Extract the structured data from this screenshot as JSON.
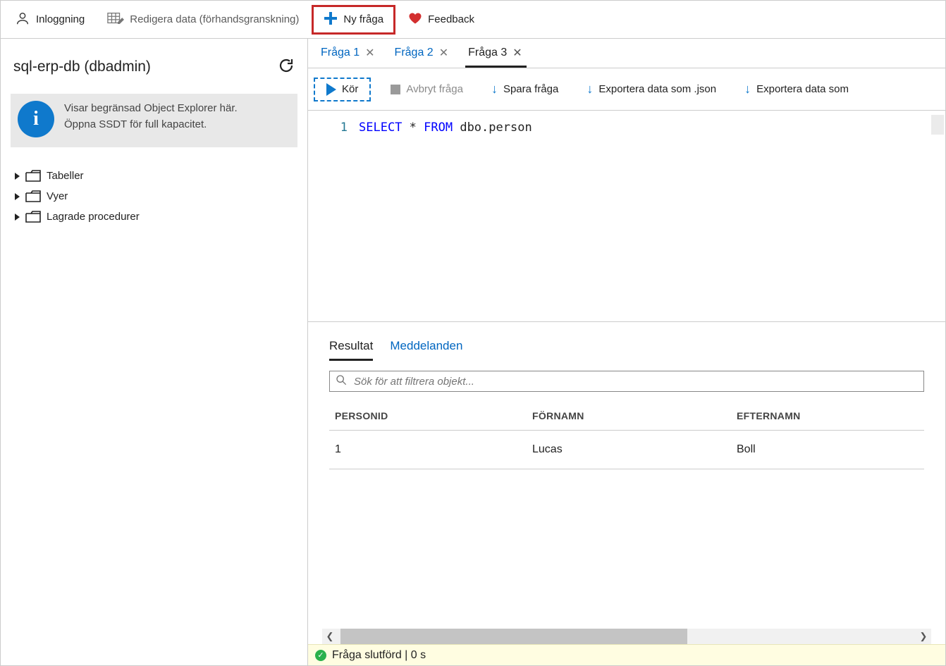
{
  "top_toolbar": {
    "login_label": "Inloggning",
    "edit_data_label": "Redigera data (förhandsgranskning)",
    "new_query_label": "Ny fråga",
    "feedback_label": "Feedback"
  },
  "sidebar": {
    "title": "sql-erp-db (dbadmin)",
    "info_line1": "Visar begränsad Object Explorer här.",
    "info_line2": "Öppna SSDT för full kapacitet.",
    "tree_items": [
      {
        "label": "Tabeller"
      },
      {
        "label": "Vyer"
      },
      {
        "label": "Lagrade procedurer"
      }
    ]
  },
  "main": {
    "tabs": [
      {
        "label": "Fråga 1",
        "active": false
      },
      {
        "label": "Fråga 2",
        "active": false
      },
      {
        "label": "Fråga 3",
        "active": true
      }
    ],
    "query_toolbar": {
      "run_label": "Kör",
      "cancel_label": "Avbryt fråga",
      "save_label": "Spara fråga",
      "export_json_label": "Exportera data som .json",
      "export_more_label": "Exportera data som"
    },
    "editor": {
      "line_number": "1",
      "kw_select": "SELECT",
      "star": " * ",
      "kw_from": "FROM",
      "rest": " dbo.person"
    },
    "results": {
      "tab_result": "Resultat",
      "tab_messages": "Meddelanden",
      "filter_placeholder": "Sök för att filtrera objekt...",
      "columns": [
        "PERSONID",
        "FÖRNAMN",
        "EFTERNAMN"
      ],
      "rows": [
        [
          "1",
          "Lucas",
          "Boll"
        ]
      ]
    },
    "status_text": "Fråga slutförd | 0 s"
  }
}
